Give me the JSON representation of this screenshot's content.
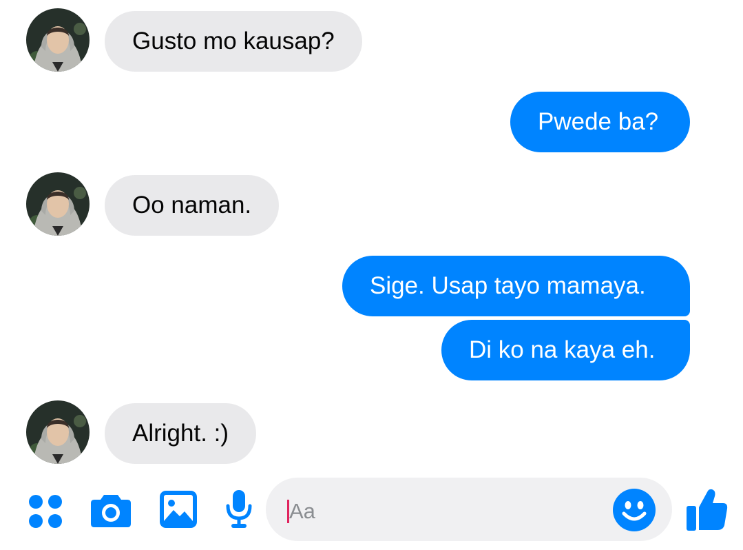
{
  "messages": [
    {
      "sender": "them",
      "text": "Gusto mo kausap?"
    },
    {
      "sender": "me",
      "text": "Pwede ba?"
    },
    {
      "sender": "them",
      "text": "Oo naman."
    },
    {
      "sender": "me",
      "text": "Sige. Usap tayo mamaya."
    },
    {
      "sender": "me",
      "text": "Di ko na kaya eh."
    },
    {
      "sender": "them",
      "text": "Alright. :)"
    }
  ],
  "composer": {
    "placeholder": "Aa",
    "icons": [
      "menu-dots-icon",
      "camera-icon",
      "gallery-icon",
      "microphone-icon",
      "emoji-icon",
      "thumbs-up-icon"
    ]
  },
  "colors": {
    "accent": "#0084ff",
    "incoming_bubble": "#e9e9eb",
    "caret": "#e0245e"
  }
}
